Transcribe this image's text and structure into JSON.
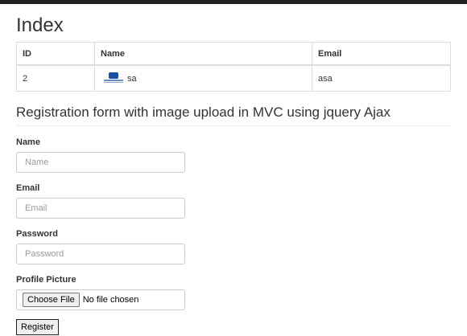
{
  "page": {
    "title": "Index"
  },
  "table": {
    "headers": [
      "ID",
      "Name",
      "Email"
    ],
    "rows": [
      {
        "id": "2",
        "name": "sa",
        "email": "asa",
        "image_icon": "profile-thumbnail"
      }
    ]
  },
  "form": {
    "heading": "Registration form with image upload in MVC using jquery Ajax",
    "name": {
      "label": "Name",
      "placeholder": "Name",
      "value": ""
    },
    "email": {
      "label": "Email",
      "placeholder": "Email",
      "value": ""
    },
    "password": {
      "label": "Password",
      "placeholder": "Password",
      "value": ""
    },
    "picture": {
      "label": "Profile Picture",
      "button_label": "Choose File",
      "status": "No file chosen"
    },
    "submit_label": "Register"
  },
  "colors": {
    "topbar": "#222222",
    "border": "#dddddd"
  }
}
